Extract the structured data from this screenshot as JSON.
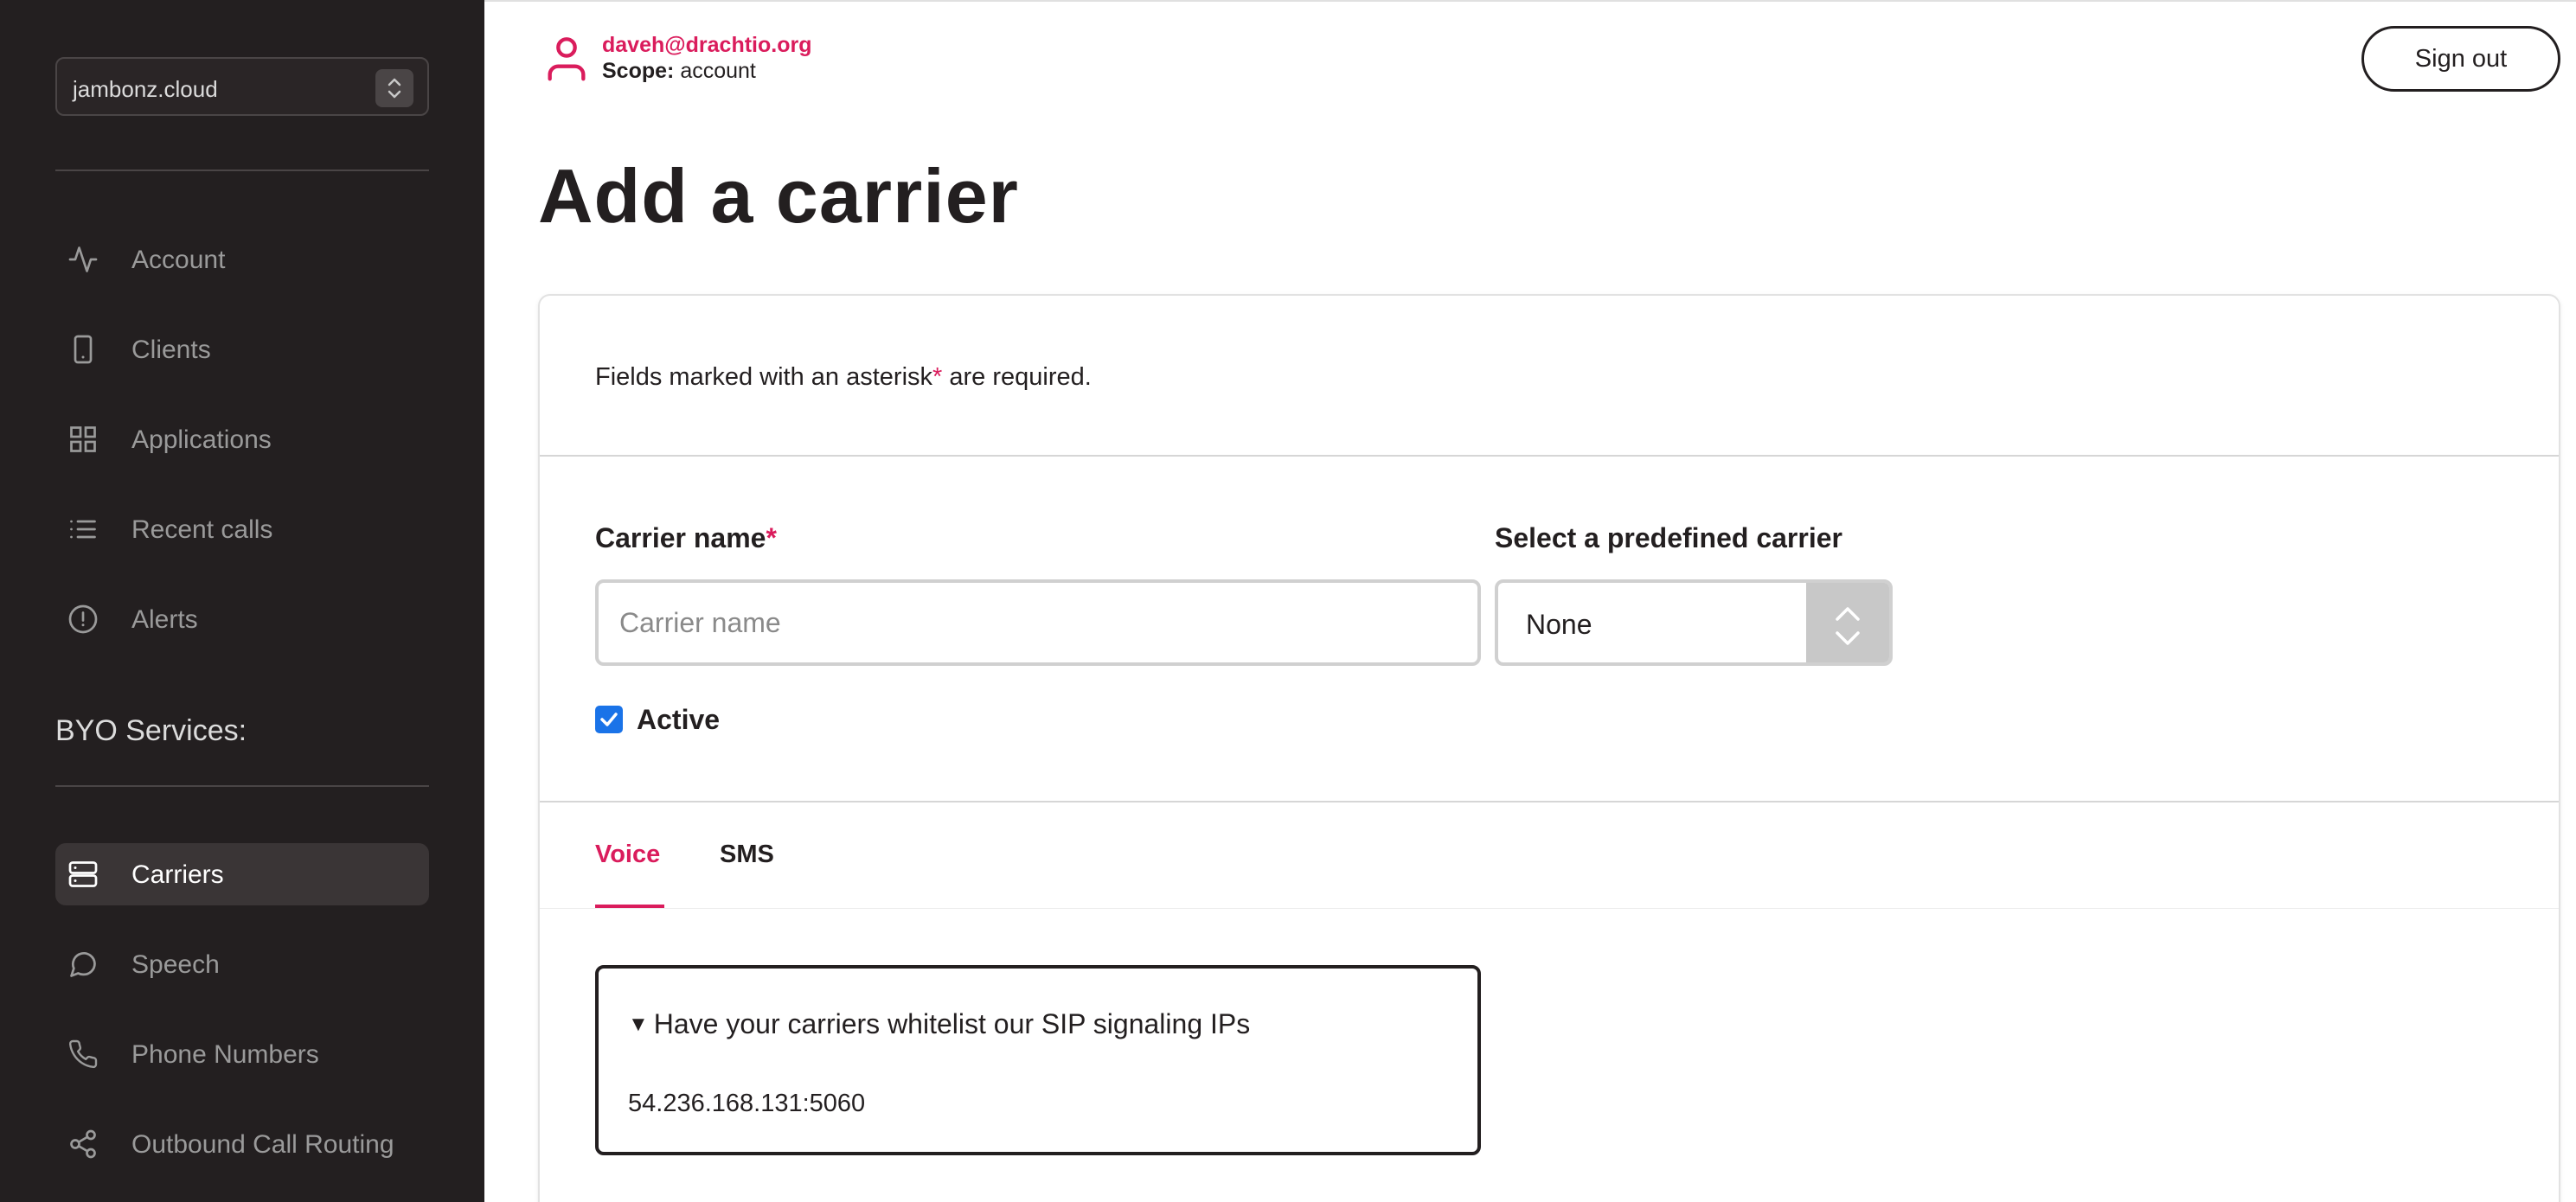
{
  "sidebar": {
    "account_selector": "jambonz.cloud",
    "nav_items": [
      {
        "label": "Account",
        "icon": "activity-icon"
      },
      {
        "label": "Clients",
        "icon": "smartphone-icon"
      },
      {
        "label": "Applications",
        "icon": "grid-icon"
      },
      {
        "label": "Recent calls",
        "icon": "list-icon"
      },
      {
        "label": "Alerts",
        "icon": "alert-circle-icon"
      }
    ],
    "byo_title": "BYO Services:",
    "byo_items": [
      {
        "label": "Carriers",
        "icon": "server-icon",
        "active": true
      },
      {
        "label": "Speech",
        "icon": "message-circle-icon"
      },
      {
        "label": "Phone Numbers",
        "icon": "phone-icon"
      },
      {
        "label": "Outbound Call Routing",
        "icon": "share-icon"
      }
    ]
  },
  "header": {
    "email": "daveh@drachtio.org",
    "scope_label": "Scope:",
    "scope_value": "account",
    "sign_out": "Sign out"
  },
  "page": {
    "title": "Add a carrier",
    "required_note_prefix": "Fields marked with an asterisk",
    "required_note_star": "*",
    "required_note_suffix": " are required."
  },
  "form": {
    "carrier_name_label": "Carrier name",
    "carrier_name_star": "*",
    "carrier_name_placeholder": "Carrier name",
    "carrier_name_value": "",
    "predefined_label": "Select a predefined carrier",
    "predefined_value": "None",
    "active_label": "Active",
    "active_checked": true
  },
  "tabs": {
    "voice": "Voice",
    "sms": "SMS",
    "selected": "Voice"
  },
  "whitelist": {
    "summary": "Have your carriers whitelist our SIP signaling IPs",
    "ip": "54.236.168.131:5060"
  },
  "colors": {
    "accent": "#da1c5c",
    "sidebar_bg": "#231f20",
    "checkbox": "#1a73e8"
  }
}
